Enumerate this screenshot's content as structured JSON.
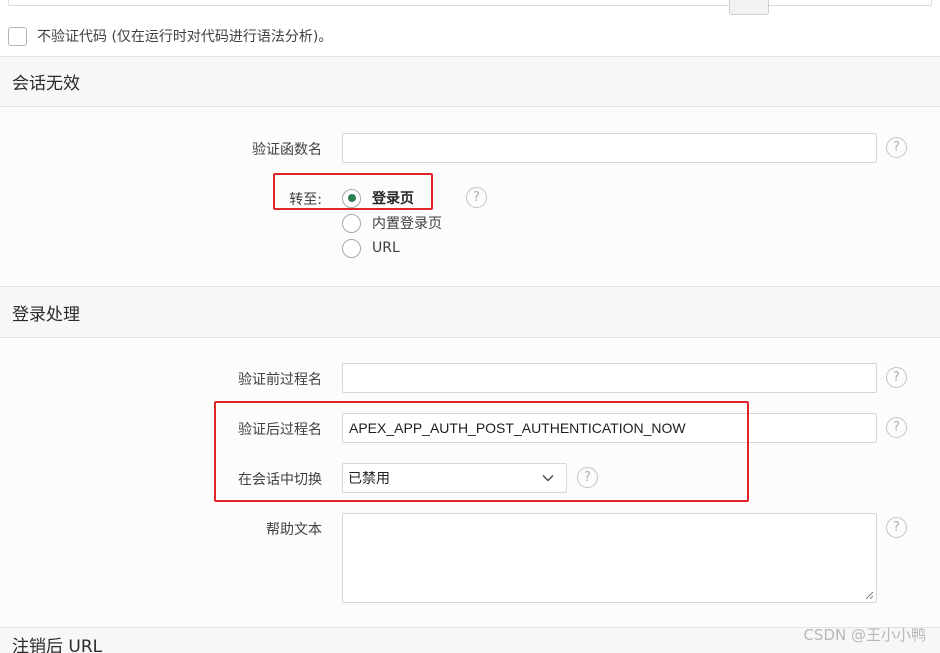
{
  "checkbox_option": {
    "label": "不验证代码 (仅在运行时对代码进行语法分析)。",
    "checked": false
  },
  "session_invalid": {
    "title": "会话无效",
    "auth_function_label": "验证函数名",
    "auth_function_value": "",
    "goto_label": "转至:",
    "goto_options": [
      "登录页",
      "内置登录页",
      "URL"
    ],
    "goto_selected": "登录页"
  },
  "login_processing": {
    "title": "登录处理",
    "pre_auth_label": "验证前过程名",
    "pre_auth_value": "",
    "post_auth_label": "验证后过程名",
    "post_auth_value": "APEX_APP_AUTH_POST_AUTHENTICATION_NOW",
    "switch_label": "在会话中切换",
    "switch_value": "已禁用",
    "help_text_label": "帮助文本",
    "help_text_value": ""
  },
  "help_glyph": "?",
  "next_section": {
    "title": "注销后 URL"
  },
  "watermark": "CSDN @王小小鸭",
  "colors": {
    "highlight": "#e0242a",
    "radio_selected": "#2d7f4e",
    "section_header_bg": "#f7f7f7"
  }
}
